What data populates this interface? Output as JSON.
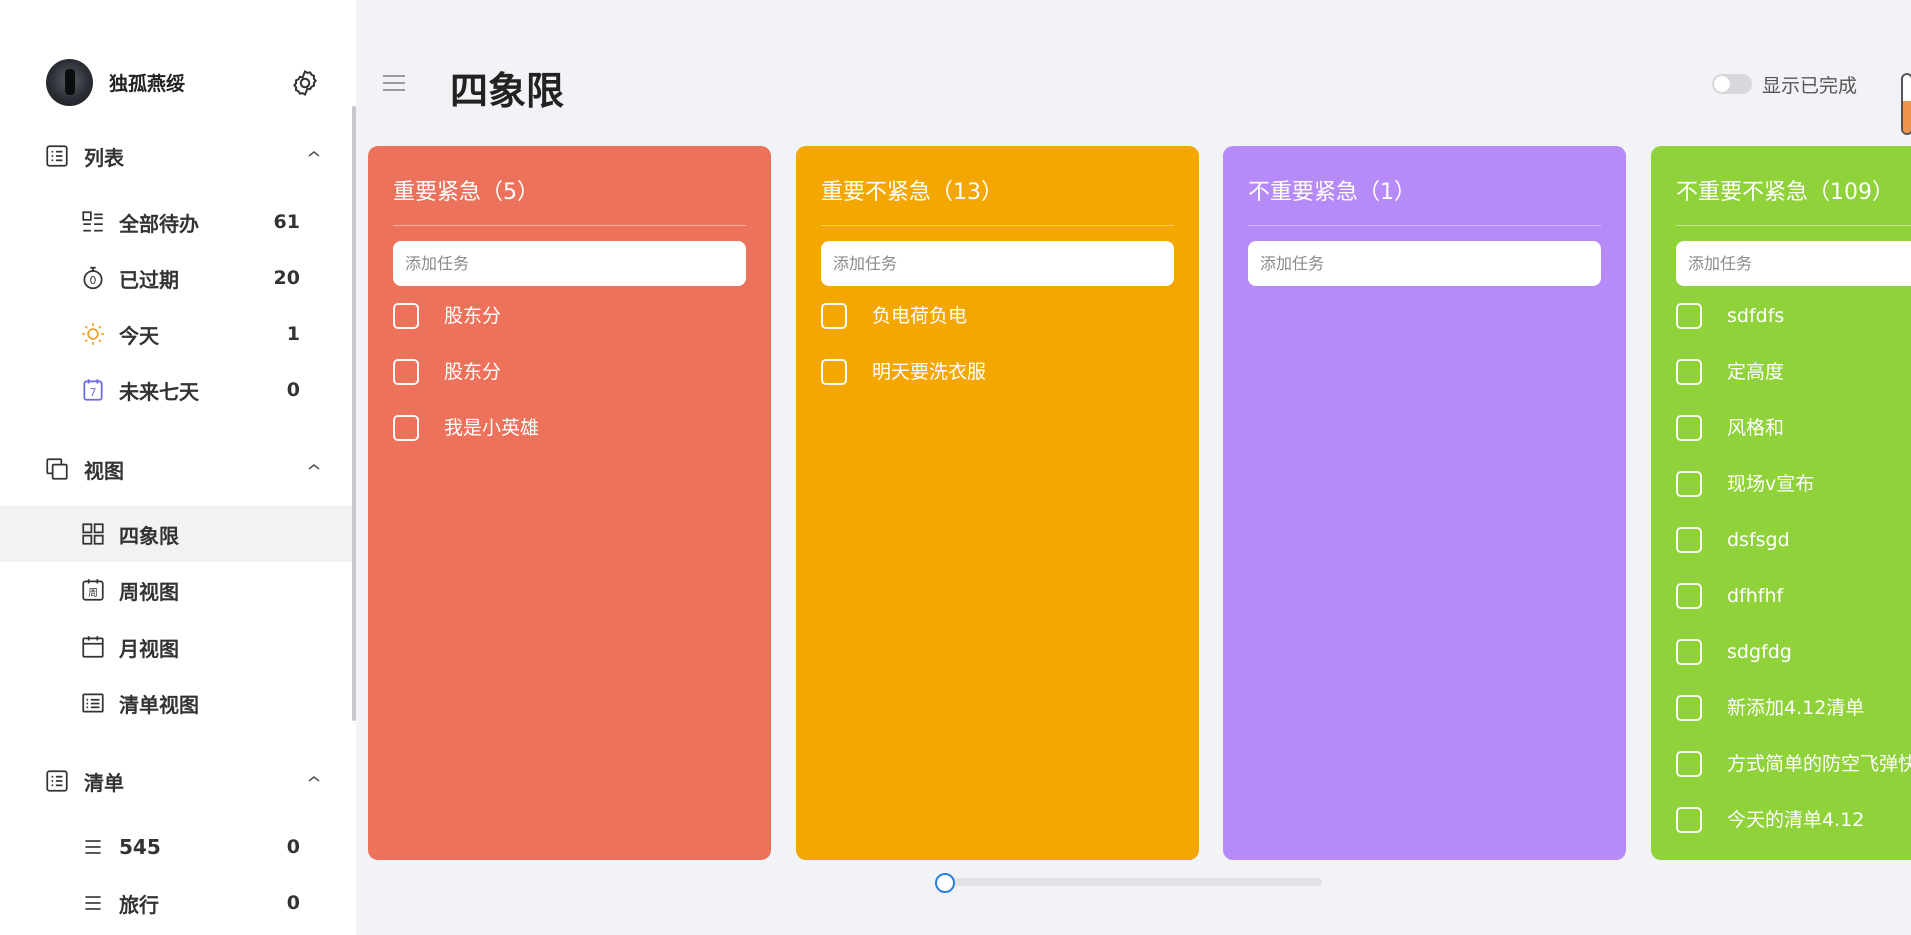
{
  "user": {
    "name": "独孤燕绥"
  },
  "sections": {
    "list": {
      "label": "列表"
    },
    "view": {
      "label": "视图"
    },
    "checklist": {
      "label": "清单"
    }
  },
  "list_items": [
    {
      "label": "全部待办",
      "count": "61",
      "icon": "all-tasks-icon"
    },
    {
      "label": "已过期",
      "count": "20",
      "icon": "timer-icon"
    },
    {
      "label": "今天",
      "count": "1",
      "icon": "sun-icon"
    },
    {
      "label": "未来七天",
      "count": "0",
      "icon": "calendar-7-icon"
    }
  ],
  "view_items": [
    {
      "label": "四象限",
      "icon": "quadrant-icon",
      "active": true
    },
    {
      "label": "周视图",
      "icon": "week-calendar-icon"
    },
    {
      "label": "月视图",
      "icon": "month-calendar-icon"
    },
    {
      "label": "清单视图",
      "icon": "list-view-icon"
    }
  ],
  "checklist_items": [
    {
      "label": "545",
      "count": "0",
      "icon": "hamburger-icon"
    },
    {
      "label": "旅行",
      "count": "0",
      "icon": "hamburger-icon"
    }
  ],
  "header": {
    "title": "四象限",
    "show_completed_label": "显示已完成",
    "show_completed_on": false
  },
  "colors": {
    "q1": "#ec725c",
    "q2": "#f4a700",
    "q3": "#b68bf8",
    "q4": "#8fd23a",
    "scroll_accent": "#2a7de1"
  },
  "columns": [
    {
      "title": "重要紧急（5）",
      "placeholder": "添加任务",
      "tasks": [
        "股东分",
        "股东分",
        "我是小英雄"
      ]
    },
    {
      "title": "重要不紧急（13）",
      "placeholder": "添加任务",
      "tasks": [
        "负电荷负电",
        "明天要洗衣服"
      ]
    },
    {
      "title": "不重要紧急（1）",
      "placeholder": "添加任务",
      "tasks": []
    },
    {
      "title": "不重要不紧急（109）",
      "placeholder": "添加任务",
      "tasks": [
        "sdfdfs",
        "定高度",
        "风格和",
        "现场v宣布",
        "dsfsgd",
        "dfhfhf",
        "sdgfdg",
        "新添加4.12清单",
        "方式简单的防空飞弹快",
        "今天的清单4.12"
      ]
    }
  ]
}
